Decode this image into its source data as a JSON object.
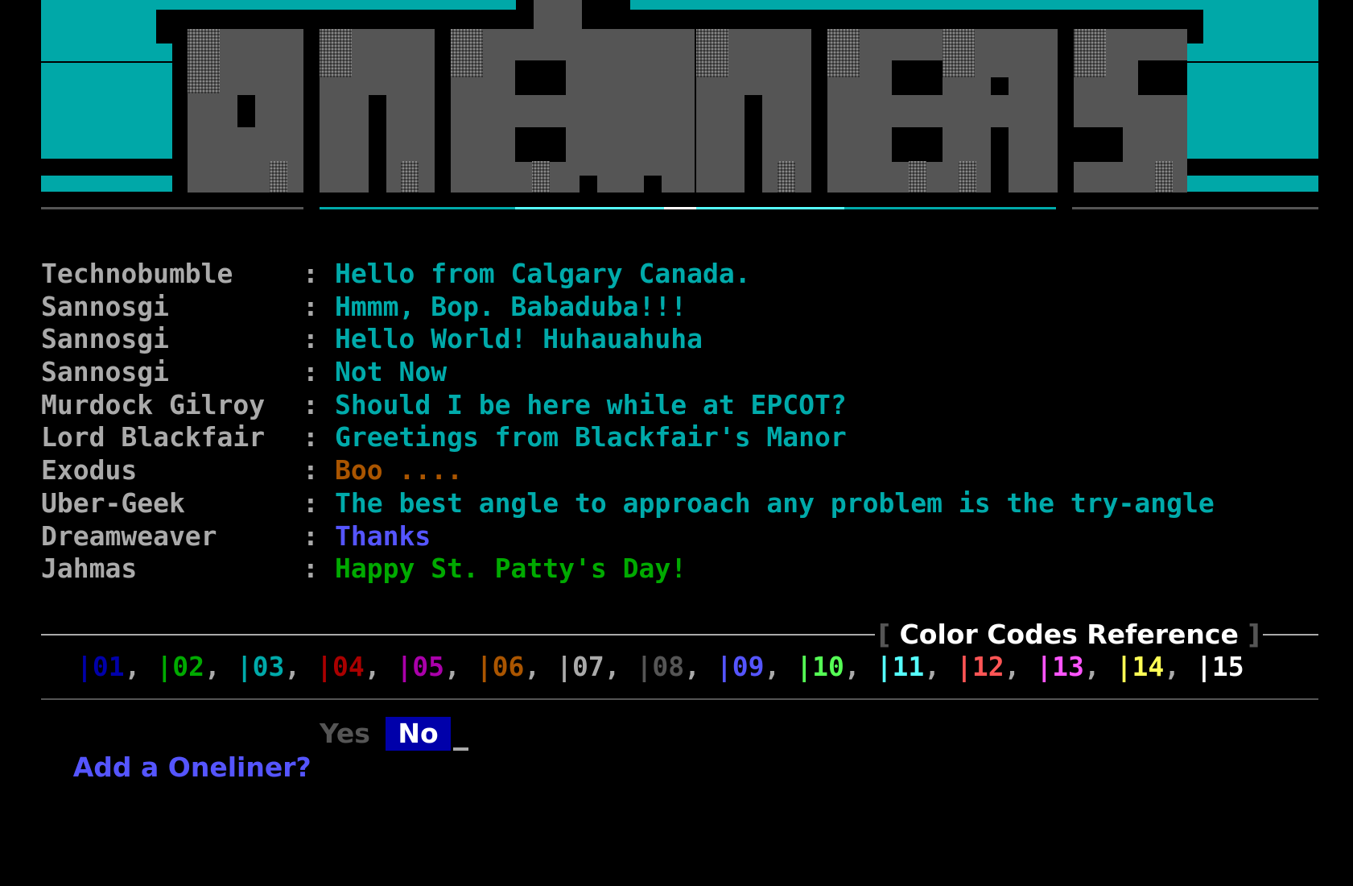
{
  "banner": {
    "title": "ONELINERS",
    "colors": {
      "background": "#00a8a8",
      "letters": "#555555",
      "shadow": "#000000"
    }
  },
  "oneliners": [
    {
      "user": "Technobumble",
      "sep": ":",
      "message": "Hello from Calgary Canada.",
      "color": "#00aaaa"
    },
    {
      "user": "Sannosgi",
      "sep": ":",
      "message": "Hmmm, Bop. Babaduba!!!",
      "color": "#00aaaa"
    },
    {
      "user": "Sannosgi",
      "sep": ":",
      "message": "Hello World! Huhauahuha",
      "color": "#00aaaa"
    },
    {
      "user": "Sannosgi",
      "sep": ":",
      "message": "Not Now",
      "color": "#00aaaa"
    },
    {
      "user": "Murdock Gilroy",
      "sep": ":",
      "message": "Should I be here while at EPCOT?",
      "color": "#00aaaa"
    },
    {
      "user": "Lord Blackfair",
      "sep": ":",
      "message": "Greetings from Blackfair's Manor",
      "color": "#00aaaa"
    },
    {
      "user": "Exodus",
      "sep": ":",
      "message": "Boo ....",
      "color": "#aa5500"
    },
    {
      "user": "Uber-Geek",
      "sep": ":",
      "message": "The best angle to approach any problem is the try-angle",
      "color": "#00aaaa"
    },
    {
      "user": "Dreamweaver",
      "sep": ":",
      "message": "Thanks",
      "color": "#5555ff"
    },
    {
      "user": "Jahmas",
      "sep": ":",
      "message": "Happy St. Patty's Day!",
      "color": "#00aa00"
    }
  ],
  "color_reference": {
    "open_bracket": "[",
    "title": " Color Codes Reference ",
    "close_bracket": "]",
    "codes": [
      {
        "code": "|01",
        "color": "#0000aa"
      },
      {
        "code": "|02",
        "color": "#00aa00"
      },
      {
        "code": "|03",
        "color": "#00aaaa"
      },
      {
        "code": "|04",
        "color": "#aa0000"
      },
      {
        "code": "|05",
        "color": "#aa00aa"
      },
      {
        "code": "|06",
        "color": "#aa5500"
      },
      {
        "code": "|07",
        "color": "#aaaaaa"
      },
      {
        "code": "|08",
        "color": "#555555"
      },
      {
        "code": "|09",
        "color": "#5555ff"
      },
      {
        "code": "|10",
        "color": "#55ff55"
      },
      {
        "code": "|11",
        "color": "#55ffff"
      },
      {
        "code": "|12",
        "color": "#ff5555"
      },
      {
        "code": "|13",
        "color": "#ff55ff"
      },
      {
        "code": "|14",
        "color": "#ffff55"
      },
      {
        "code": "|15",
        "color": "#ffffff"
      }
    ]
  },
  "prompt": {
    "question": "Add a Oneliner?",
    "yes_label": "Yes",
    "no_label": "No",
    "selected": "No"
  }
}
